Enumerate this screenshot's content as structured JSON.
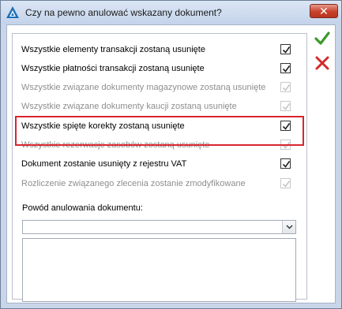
{
  "window": {
    "title": "Czy na pewno anulować wskazany dokument?",
    "close_label": "✕"
  },
  "options": [
    {
      "label": "Wszystkie elementy transakcji zostaną usunięte",
      "checked": true,
      "enabled": true
    },
    {
      "label": "Wszystkie płatności transakcji zostaną usunięte",
      "checked": true,
      "enabled": true
    },
    {
      "label": "Wszystkie związane dokumenty magazynowe zostaną usunięte",
      "checked": true,
      "enabled": false
    },
    {
      "label": "Wszystkie związane dokumenty kaucji zostaną usunięte",
      "checked": true,
      "enabled": false
    },
    {
      "label": "Wszystkie spięte korekty zostaną usunięte",
      "checked": true,
      "enabled": true
    },
    {
      "label": "Wszystkie rezerwacje zasobów zostaną usunięte",
      "checked": true,
      "enabled": false
    },
    {
      "label": "Dokument zostanie usunięty z rejestru VAT",
      "checked": true,
      "enabled": true
    },
    {
      "label": "Rozliczenie związanego zlecenia zostanie zmodyfikowane",
      "checked": true,
      "enabled": false
    }
  ],
  "reason": {
    "label": "Powód anulowania dokumentu:",
    "selected": "",
    "text": ""
  },
  "buttons": {
    "confirm_icon": "checkmark-icon",
    "cancel_icon": "x-icon"
  },
  "colors": {
    "highlight": "#d7262e",
    "confirm": "#3b9a2a",
    "cancel": "#d32b2b"
  }
}
